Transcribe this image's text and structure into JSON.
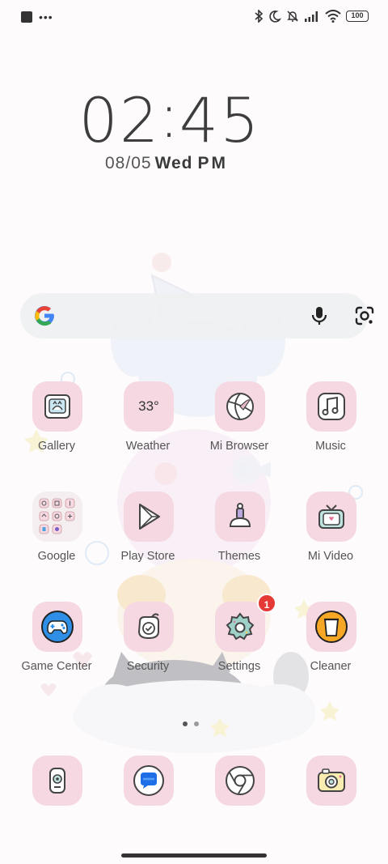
{
  "status_bar": {
    "left_icons": [
      "notification-square-icon",
      "more-dots-icon"
    ],
    "right_icons": [
      "bluetooth-icon",
      "moon-icon",
      "bell-off-icon",
      "signal-icon",
      "wifi-icon"
    ],
    "battery": "100"
  },
  "clock": {
    "hours": "02",
    "separator": ":",
    "minutes": "45",
    "date": "08/05",
    "day": "Wed",
    "ampm": "PM"
  },
  "search": {
    "icons": [
      "google-logo-icon",
      "microphone-icon",
      "google-lens-icon"
    ]
  },
  "apps": {
    "row1": [
      {
        "label": "Gallery",
        "icon": "gallery-icon"
      },
      {
        "label": "Weather",
        "icon": "weather-icon",
        "temp": "33°"
      },
      {
        "label": "Mi Browser",
        "icon": "browser-icon"
      },
      {
        "label": "Music",
        "icon": "music-icon"
      }
    ],
    "row2": [
      {
        "label": "Google",
        "icon": "google-folder-icon"
      },
      {
        "label": "Play Store",
        "icon": "play-store-icon"
      },
      {
        "label": "Themes",
        "icon": "themes-icon"
      },
      {
        "label": "Mi Video",
        "icon": "tv-icon"
      }
    ],
    "row3": [
      {
        "label": "Game Center",
        "icon": "gamepad-icon"
      },
      {
        "label": "Security",
        "icon": "shield-check-icon"
      },
      {
        "label": "Settings",
        "icon": "gear-icon",
        "badge": "1"
      },
      {
        "label": "Cleaner",
        "icon": "trash-can-icon"
      }
    ]
  },
  "dock": [
    {
      "icon": "phone-icon"
    },
    {
      "icon": "messages-icon"
    },
    {
      "icon": "chrome-icon"
    },
    {
      "icon": "camera-icon"
    }
  ],
  "colors": {
    "tile": "#f6d8e2",
    "badge": "#e53935",
    "accent_blue": "#2f8fe6",
    "accent_orange": "#f7a726"
  }
}
